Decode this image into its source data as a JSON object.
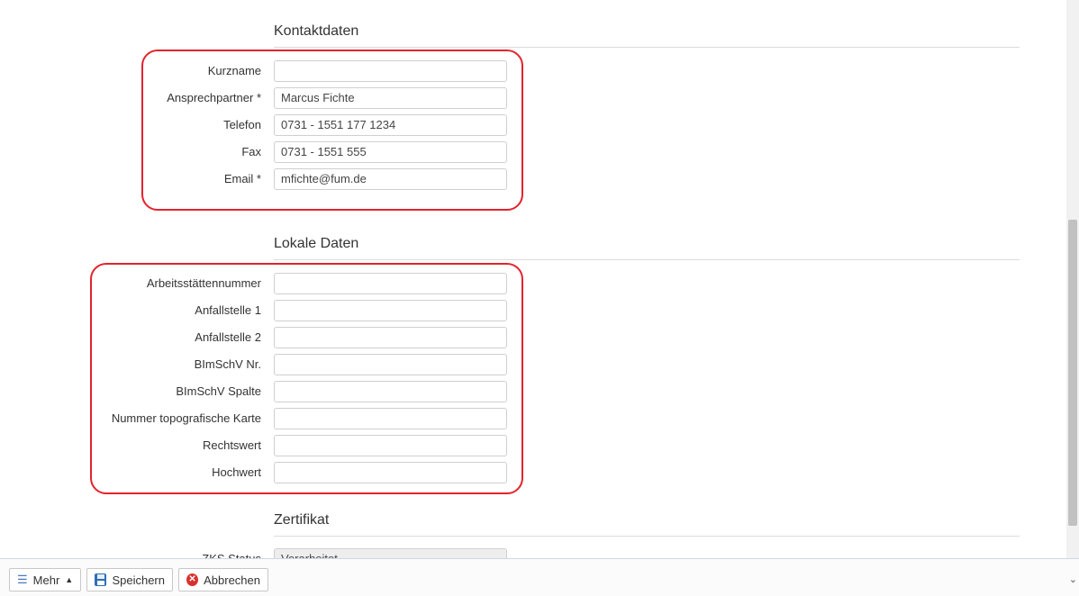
{
  "sections": {
    "contact": {
      "title": "Kontaktdaten",
      "fields": [
        {
          "label": "Kurzname",
          "value": ""
        },
        {
          "label": "Ansprechpartner *",
          "value": "Marcus Fichte"
        },
        {
          "label": "Telefon",
          "value": "0731 - 1551 177 1234"
        },
        {
          "label": "Fax",
          "value": "0731 - 1551 555"
        },
        {
          "label": "Email *",
          "value": "mfichte@fum.de"
        }
      ]
    },
    "local": {
      "title": "Lokale Daten",
      "fields": [
        {
          "label": "Arbeitsstättennummer",
          "value": ""
        },
        {
          "label": "Anfallstelle 1",
          "value": ""
        },
        {
          "label": "Anfallstelle 2",
          "value": ""
        },
        {
          "label": "BImSchV Nr.",
          "value": ""
        },
        {
          "label": "BImSchV Spalte",
          "value": ""
        },
        {
          "label": "Nummer topografische Karte",
          "value": ""
        },
        {
          "label": "Rechtswert",
          "value": ""
        },
        {
          "label": "Hochwert",
          "value": ""
        }
      ]
    },
    "certificate": {
      "title": "Zertifikat",
      "fields": [
        {
          "label": "ZKS Status",
          "value": "Verarbeitet"
        }
      ]
    }
  },
  "footer": {
    "more_label": "Mehr",
    "save_label": "Speichern",
    "cancel_label": "Abbrechen"
  },
  "colors": {
    "highlight": "#e3232d",
    "cancel_icon": "#d9302c",
    "save_icon": "#2c6fb7"
  },
  "icons": {
    "more": "list-icon",
    "more_caret": "caret-up-icon",
    "save": "floppy-disk-icon",
    "cancel": "close-circle-icon",
    "scroll": "chevron-down-icon"
  }
}
